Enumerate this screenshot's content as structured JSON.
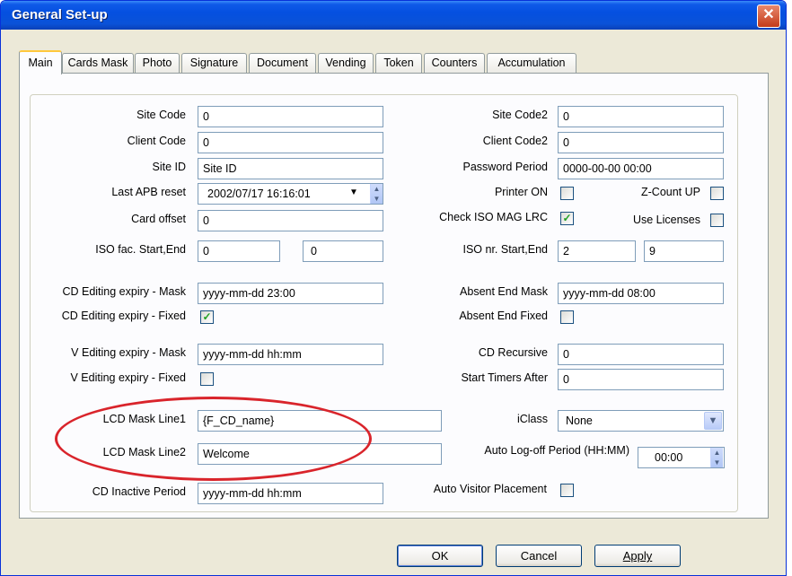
{
  "window": {
    "title": "General Set-up",
    "close_glyph": "✕"
  },
  "tabs": [
    "Main",
    "Cards Mask",
    "Photo",
    "Signature",
    "Document",
    "Vending",
    "Token",
    "Counters",
    "Accumulation"
  ],
  "left": {
    "site_code_label": "Site Code",
    "site_code_value": "0",
    "client_code_label": "Client Code",
    "client_code_value": "0",
    "site_id_label": "Site ID",
    "site_id_value": "Site ID",
    "last_apb_label": "Last APB reset",
    "last_apb_value": "2002/07/17 16:16:01",
    "card_offset_label": "Card offset",
    "card_offset_value": "0",
    "iso_fac_label": "ISO fac. Start,End",
    "iso_fac_start": "0",
    "iso_fac_end": "0",
    "cd_mask_label": "CD Editing expiry - Mask",
    "cd_mask_value": "yyyy-mm-dd 23:00",
    "cd_fixed_label": "CD Editing expiry - Fixed",
    "v_mask_label": "V Editing expiry - Mask",
    "v_mask_value": "yyyy-mm-dd hh:mm",
    "v_fixed_label": "V Editing expiry - Fixed",
    "lcd1_label": "LCD Mask Line1",
    "lcd1_value": "{F_CD_name}",
    "lcd2_label": "LCD Mask Line2",
    "lcd2_value": "Welcome",
    "cd_inactive_label": "CD Inactive Period",
    "cd_inactive_value": "yyyy-mm-dd hh:mm"
  },
  "right": {
    "site_code2_label": "Site Code2",
    "site_code2_value": "0",
    "client_code2_label": "Client Code2",
    "client_code2_value": "0",
    "password_period_label": "Password Period",
    "password_period_value": "0000-00-00 00:00",
    "printer_on_label": "Printer ON",
    "zcount_label": "Z-Count UP",
    "check_iso_label": "Check ISO MAG LRC",
    "use_licenses_label": "Use Licenses",
    "iso_nr_label": "ISO nr. Start,End",
    "iso_nr_start": "2",
    "iso_nr_end": "9",
    "absent_mask_label": "Absent End Mask",
    "absent_mask_value": "yyyy-mm-dd 08:00",
    "absent_fixed_label": "Absent End Fixed",
    "cd_recursive_label": "CD Recursive",
    "cd_recursive_value": "0",
    "start_timers_label": "Start Timers After",
    "start_timers_value": "0",
    "iclass_label": "iClass",
    "iclass_value": "None",
    "auto_logoff_label": "Auto Log-off Period (HH:MM)",
    "auto_logoff_value": "00:00",
    "auto_visitor_label": "Auto Visitor Placement"
  },
  "checkmark": "✓",
  "buttons": {
    "ok": "OK",
    "cancel": "Cancel",
    "apply": "Apply"
  },
  "colors": {
    "title_bar": "#0550e0",
    "annotation_oval": "#d9242b",
    "check": "#21a121"
  }
}
